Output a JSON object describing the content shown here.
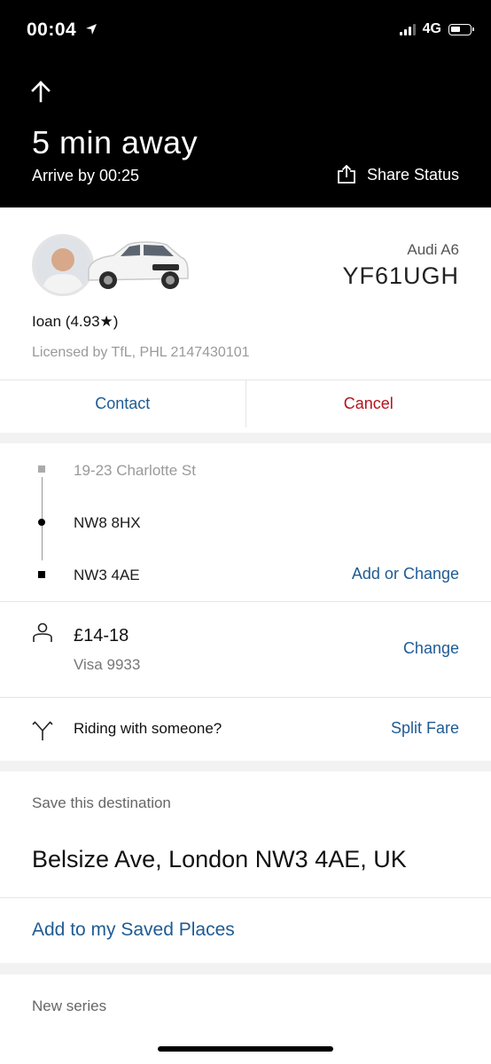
{
  "status_bar": {
    "time": "00:04",
    "network": "4G",
    "location_icon": "location-arrow-icon"
  },
  "header": {
    "eta": "5 min away",
    "arrive": "Arrive by 00:25",
    "share_label": "Share Status",
    "back_icon": "up-arrow-icon",
    "share_icon": "share-icon"
  },
  "driver": {
    "car_model": "Audi A6",
    "plate": "YF61UGH",
    "name_rating": "Ioan (4.93★)",
    "license": "Licensed by TfL, PHL 2147430101",
    "contact_label": "Contact",
    "cancel_label": "Cancel"
  },
  "trip": {
    "stops": [
      "19-23 Charlotte St",
      "NW8 8HX",
      "NW3 4AE"
    ],
    "add_change_label": "Add or Change",
    "fare": "£14-18",
    "payment": "Visa 9933",
    "change_label": "Change",
    "riding_text": "Riding with someone?",
    "split_label": "Split Fare"
  },
  "save_destination": {
    "title": "Save this destination",
    "address": "Belsize Ave, London NW3 4AE, UK",
    "add_saved_label": "Add to my Saved Places"
  },
  "series": {
    "title": "New series"
  },
  "colors": {
    "link_blue": "#1f5b93",
    "cancel_red": "#b3141d",
    "header_bg": "#000000",
    "separator": "#000000"
  }
}
